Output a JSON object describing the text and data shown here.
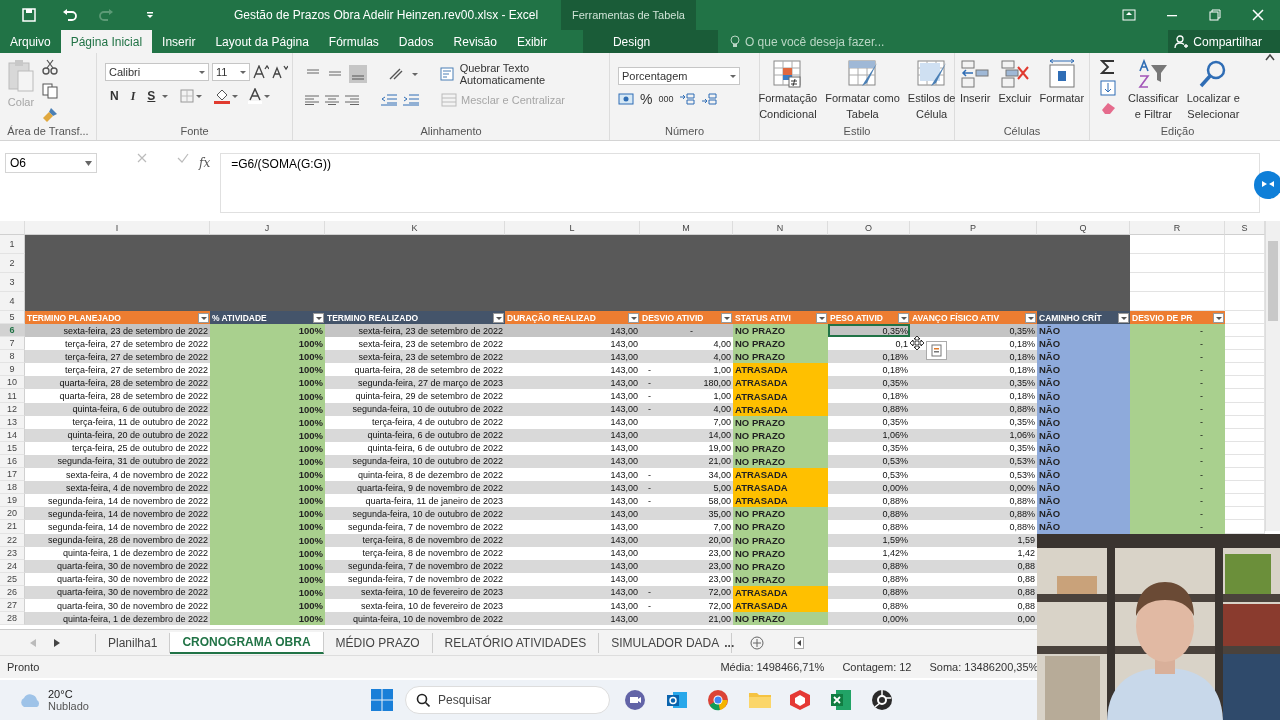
{
  "window": {
    "title": "Gestão de Prazos Obra Adelir Heinzen.rev00.xlsx - Excel",
    "context_group": "Ferramentas de Tabela"
  },
  "ribbon_tabs": [
    {
      "label": "Arquivo",
      "selected": false
    },
    {
      "label": "Página Inicial",
      "selected": true
    },
    {
      "label": "Inserir",
      "selected": false
    },
    {
      "label": "Layout da Página",
      "selected": false
    },
    {
      "label": "Fórmulas",
      "selected": false
    },
    {
      "label": "Dados",
      "selected": false
    },
    {
      "label": "Revisão",
      "selected": false
    },
    {
      "label": "Exibir",
      "selected": false
    },
    {
      "label": "Design",
      "selected": false
    }
  ],
  "tell_me": {
    "placeholder": "O que você deseja fazer..."
  },
  "share_button": "Compartilhar",
  "ribbon": {
    "clipboard": {
      "paste": "Colar",
      "group": "Área de Transf..."
    },
    "font": {
      "name": "Calibri",
      "size": "11",
      "bold": "N",
      "italic": "I",
      "underline": "S",
      "group": "Fonte"
    },
    "alignment": {
      "wrap": "Quebrar Texto Automaticamente",
      "merge": {
        "label": "Mesclar e Centralizar",
        "disabled": true
      },
      "group": "Alinhamento"
    },
    "number": {
      "format": "Porcentagem",
      "percent": "%",
      "thousands": "000",
      "group": "Número"
    },
    "styles": {
      "buttons": [
        {
          "lines": [
            "Formatação",
            "Condicional"
          ]
        },
        {
          "lines": [
            "Formatar como",
            "Tabela"
          ]
        },
        {
          "lines": [
            "Estilos de",
            "Célula"
          ]
        }
      ],
      "group": "Estilo"
    },
    "cells": {
      "buttons": [
        "Inserir",
        "Excluir",
        "Formatar"
      ],
      "group": "Células"
    },
    "editing": {
      "buttons": [
        {
          "lines": [
            "Classificar",
            "e Filtrar"
          ]
        },
        {
          "lines": [
            "Localizar e",
            "Selecionar"
          ]
        }
      ],
      "group": "Edição"
    }
  },
  "formula_bar": {
    "name_box": "O6",
    "function_label": "fx",
    "formula": "=G6/(SOMA(G:G))"
  },
  "sheet": {
    "column_letters": [
      "I",
      "J",
      "K",
      "L",
      "M",
      "N",
      "O",
      "P",
      "Q",
      "R",
      "S"
    ],
    "top_rows": [
      "1",
      "2",
      "3",
      "4"
    ],
    "header_row": "5",
    "headers": [
      {
        "label": "TERMINO PLANEJADO",
        "color": "#ed7d31"
      },
      {
        "label": "% ATIVIDADE",
        "color": "#44546a"
      },
      {
        "label": "TERMINO REALIZADO",
        "color": "#44546a"
      },
      {
        "label": "DURAÇÃO REALIZAD",
        "color": "#ed7d31"
      },
      {
        "label": "DESVIO ATIVID",
        "color": "#ed7d31"
      },
      {
        "label": "STATUS ATIVI",
        "color": "#ed7d31"
      },
      {
        "label": "PESO ATIVID",
        "color": "#ed7d31"
      },
      {
        "label": "AVANÇO FÍSICO ATIV",
        "color": "#ed7d31"
      },
      {
        "label": "CAMINHO CRÍT",
        "color": "#44546a"
      },
      {
        "label": "DESVIO DE PR",
        "color": "#ed7d31"
      }
    ],
    "rows": [
      {
        "row": "6",
        "selected": true,
        "planned": "sexta-feira, 23 de setembro de 2022",
        "activity": "100%",
        "realized": "sexta-feira, 23 de setembro de 2022",
        "duration": "143,00",
        "deviation": "-",
        "status": {
          "label": "NO PRAZO",
          "color": "#a9d08e"
        },
        "weight": "0,35%",
        "progress": "0,35%",
        "critical": "NÃO",
        "project_deviation": "-"
      },
      {
        "row": "7",
        "selected": false,
        "planned": "terça-feira, 27 de setembro de 2022",
        "activity": "100%",
        "realized": "sexta-feira, 23 de setembro de 2022",
        "duration": "143,00",
        "deviation": "4,00",
        "status": {
          "label": "NO PRAZO",
          "color": "#a9d08e"
        },
        "weight": "0,1",
        "progress": "0,18%",
        "critical": "NÃO",
        "project_deviation": "-"
      },
      {
        "row": "8",
        "selected": false,
        "planned": "terça-feira, 27 de setembro de 2022",
        "activity": "100%",
        "realized": "sexta-feira, 23 de setembro de 2022",
        "duration": "143,00",
        "deviation": "4,00",
        "status": {
          "label": "NO PRAZO",
          "color": "#a9d08e"
        },
        "weight": "0,18%",
        "progress": "0,18%",
        "critical": "NÃO",
        "project_deviation": "-"
      },
      {
        "row": "9",
        "selected": false,
        "planned": "terça-feira, 27 de setembro de 2022",
        "activity": "100%",
        "realized": "quarta-feira, 28 de setembro de 2022",
        "duration": "143,00",
        "deviation_sign": "-",
        "deviation": "1,00",
        "status": {
          "label": "ATRASADA",
          "color": "#ffc000"
        },
        "weight": "0,18%",
        "progress": "0,18%",
        "critical": "NÃO",
        "project_deviation": "-"
      },
      {
        "row": "10",
        "selected": false,
        "planned": "quarta-feira, 28 de setembro de 2022",
        "activity": "100%",
        "realized": "segunda-feira, 27 de março de 2023",
        "duration": "143,00",
        "deviation_sign": "-",
        "deviation": "180,00",
        "status": {
          "label": "ATRASADA",
          "color": "#ffc000"
        },
        "weight": "0,35%",
        "progress": "0,35%",
        "critical": "NÃO",
        "project_deviation": "-"
      },
      {
        "row": "11",
        "selected": false,
        "planned": "quarta-feira, 28 de setembro de 2022",
        "activity": "100%",
        "realized": "quinta-feira, 29 de setembro de 2022",
        "duration": "143,00",
        "deviation_sign": "-",
        "deviation": "1,00",
        "status": {
          "label": "ATRASADA",
          "color": "#ffc000"
        },
        "weight": "0,18%",
        "progress": "0,18%",
        "critical": "NÃO",
        "project_deviation": "-"
      },
      {
        "row": "12",
        "selected": false,
        "planned": "quinta-feira, 6 de outubro de 2022",
        "activity": "100%",
        "realized": "segunda-feira, 10 de outubro de 2022",
        "duration": "143,00",
        "deviation_sign": "-",
        "deviation": "4,00",
        "status": {
          "label": "ATRASADA",
          "color": "#ffc000"
        },
        "weight": "0,88%",
        "progress": "0,88%",
        "critical": "NÃO",
        "project_deviation": "-"
      },
      {
        "row": "13",
        "selected": false,
        "planned": "terça-feira, 11 de outubro de 2022",
        "activity": "100%",
        "realized": "terça-feira, 4 de outubro de 2022",
        "duration": "143,00",
        "deviation": "7,00",
        "status": {
          "label": "NO PRAZO",
          "color": "#a9d08e"
        },
        "weight": "0,35%",
        "progress": "0,35%",
        "critical": "NÃO",
        "project_deviation": "-"
      },
      {
        "row": "14",
        "selected": false,
        "planned": "quinta-feira, 20 de outubro de 2022",
        "activity": "100%",
        "realized": "quinta-feira, 6 de outubro de 2022",
        "duration": "143,00",
        "deviation": "14,00",
        "status": {
          "label": "NO PRAZO",
          "color": "#a9d08e"
        },
        "weight": "1,06%",
        "progress": "1,06%",
        "critical": "NÃO",
        "project_deviation": "-"
      },
      {
        "row": "15",
        "selected": false,
        "planned": "terça-feira, 25 de outubro de 2022",
        "activity": "100%",
        "realized": "quinta-feira, 6 de outubro de 2022",
        "duration": "143,00",
        "deviation": "19,00",
        "status": {
          "label": "NO PRAZO",
          "color": "#a9d08e"
        },
        "weight": "0,35%",
        "progress": "0,35%",
        "critical": "NÃO",
        "project_deviation": "-"
      },
      {
        "row": "16",
        "selected": false,
        "planned": "segunda-feira, 31 de outubro de 2022",
        "activity": "100%",
        "realized": "segunda-feira, 10 de outubro de 2022",
        "duration": "143,00",
        "deviation": "21,00",
        "status": {
          "label": "NO PRAZO",
          "color": "#a9d08e"
        },
        "weight": "0,53%",
        "progress": "0,53%",
        "critical": "NÃO",
        "project_deviation": "-"
      },
      {
        "row": "17",
        "selected": false,
        "planned": "sexta-feira, 4 de novembro de 2022",
        "activity": "100%",
        "realized": "quinta-feira, 8 de dezembro de 2022",
        "duration": "143,00",
        "deviation_sign": "-",
        "deviation": "34,00",
        "status": {
          "label": "ATRASADA",
          "color": "#ffc000"
        },
        "weight": "0,53%",
        "progress": "0,53%",
        "critical": "NÃO",
        "project_deviation": "-"
      },
      {
        "row": "18",
        "selected": false,
        "planned": "sexta-feira, 4 de novembro de 2022",
        "activity": "100%",
        "realized": "quarta-feira, 9 de novembro de 2022",
        "duration": "143,00",
        "deviation_sign": "-",
        "deviation": "5,00",
        "status": {
          "label": "ATRASADA",
          "color": "#ffc000"
        },
        "weight": "0,00%",
        "progress": "0,00%",
        "critical": "NÃO",
        "project_deviation": "-"
      },
      {
        "row": "19",
        "selected": false,
        "planned": "segunda-feira, 14 de novembro de 2022",
        "activity": "100%",
        "realized": "quarta-feira, 11 de janeiro de 2023",
        "duration": "143,00",
        "deviation_sign": "-",
        "deviation": "58,00",
        "status": {
          "label": "ATRASADA",
          "color": "#ffc000"
        },
        "weight": "0,88%",
        "progress": "0,88%",
        "critical": "NÃO",
        "project_deviation": "-"
      },
      {
        "row": "20",
        "selected": false,
        "planned": "segunda-feira, 14 de novembro de 2022",
        "activity": "100%",
        "realized": "segunda-feira, 10 de outubro de 2022",
        "duration": "143,00",
        "deviation": "35,00",
        "status": {
          "label": "NO PRAZO",
          "color": "#a9d08e"
        },
        "weight": "0,88%",
        "progress": "0,88%",
        "critical": "NÃO",
        "project_deviation": "-"
      },
      {
        "row": "21",
        "selected": false,
        "planned": "segunda-feira, 14 de novembro de 2022",
        "activity": "100%",
        "realized": "segunda-feira, 7 de novembro de 2022",
        "duration": "143,00",
        "deviation": "7,00",
        "status": {
          "label": "NO PRAZO",
          "color": "#a9d08e"
        },
        "weight": "0,88%",
        "progress": "0,88%",
        "critical": "NÃO",
        "project_deviation": "-"
      },
      {
        "row": "22",
        "selected": false,
        "planned": "segunda-feira, 28 de novembro de 2022",
        "activity": "100%",
        "realized": "terça-feira, 8 de novembro de 2022",
        "duration": "143,00",
        "deviation": "20,00",
        "status": {
          "label": "NO PRAZO",
          "color": "#a9d08e"
        },
        "weight": "1,59%",
        "progress": "1,59"
      },
      {
        "row": "23",
        "selected": false,
        "planned": "quinta-feira, 1 de dezembro de 2022",
        "activity": "100%",
        "realized": "terça-feira, 8 de novembro de 2022",
        "duration": "143,00",
        "deviation": "23,00",
        "status": {
          "label": "NO PRAZO",
          "color": "#a9d08e"
        },
        "weight": "1,42%",
        "progress": "1,42"
      },
      {
        "row": "24",
        "selected": false,
        "planned": "quarta-feira, 30 de novembro de 2022",
        "activity": "100%",
        "realized": "segunda-feira, 7 de novembro de 2022",
        "duration": "143,00",
        "deviation": "23,00",
        "status": {
          "label": "NO PRAZO",
          "color": "#a9d08e"
        },
        "weight": "0,88%",
        "progress": "0,88"
      },
      {
        "row": "25",
        "selected": false,
        "planned": "quarta-feira, 30 de novembro de 2022",
        "activity": "100%",
        "realized": "segunda-feira, 7 de novembro de 2022",
        "duration": "143,00",
        "deviation": "23,00",
        "status": {
          "label": "NO PRAZO",
          "color": "#a9d08e"
        },
        "weight": "0,88%",
        "progress": "0,88"
      },
      {
        "row": "26",
        "selected": false,
        "planned": "quarta-feira, 30 de novembro de 2022",
        "activity": "100%",
        "realized": "sexta-feira, 10 de fevereiro de 2023",
        "duration": "143,00",
        "deviation_sign": "-",
        "deviation": "72,00",
        "status": {
          "label": "ATRASADA",
          "color": "#ffc000"
        },
        "weight": "0,88%",
        "progress": "0,88"
      },
      {
        "row": "27",
        "selected": false,
        "planned": "quarta-feira, 30 de novembro de 2022",
        "activity": "100%",
        "realized": "sexta-feira, 10 de fevereiro de 2023",
        "duration": "143,00",
        "deviation_sign": "-",
        "deviation": "72,00",
        "status": {
          "label": "ATRASADA",
          "color": "#ffc000"
        },
        "weight": "0,88%",
        "progress": "0,88"
      },
      {
        "row": "28",
        "selected": false,
        "planned": "quinta-feira, 1 de dezembro de 2022",
        "activity": "100%",
        "realized": "quinta-feira, 10 de novembro de 2022",
        "duration": "143,00",
        "deviation": "21,00",
        "status": {
          "label": "NO PRAZO",
          "color": "#a9d08e"
        },
        "weight": "0,00%",
        "progress": "0,00"
      }
    ]
  },
  "sheet_tabs": [
    {
      "label": "Planilha1",
      "selected": false
    },
    {
      "label": "CRONOGRAMA OBRA",
      "selected": true
    },
    {
      "label": "MÉDIO PRAZO",
      "selected": false
    },
    {
      "label": "RELATÓRIO ATIVIDADES",
      "selected": false
    },
    {
      "label": "SIMULADOR DADA",
      "selected": false
    }
  ],
  "sheet_tabs_more": "...",
  "status_bar": {
    "ready": "Pronto",
    "average": "Média: 1498466,71%",
    "count": "Contagem: 12",
    "sum": "Soma: 13486200,35%"
  },
  "taskbar": {
    "temperature": "20°C",
    "weather": "Nublado",
    "search": {
      "placeholder": "Pesquisar"
    }
  }
}
